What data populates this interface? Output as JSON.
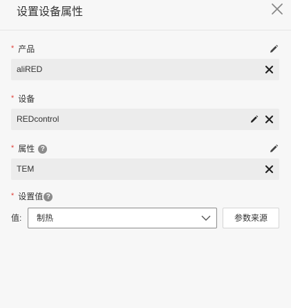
{
  "dialog": {
    "title": "设置设备属性"
  },
  "product": {
    "required_mark": "*",
    "label": "产品",
    "value": "aliRED"
  },
  "device": {
    "required_mark": "*",
    "label": "设备",
    "value": "REDcontrol"
  },
  "property": {
    "required_mark": "*",
    "label": "属性",
    "help": "?",
    "value": "TEM"
  },
  "set_value": {
    "required_mark": "*",
    "label": "设置值",
    "help": "?",
    "prefix": "值:",
    "selected": "制热",
    "param_source_button": "参数来源"
  },
  "colors": {
    "background": "#f7f7f7",
    "field_background": "#ececec",
    "required": "#e0413a",
    "help_icon": "#8c8c8c"
  },
  "icons": [
    "close-icon",
    "pencil-icon",
    "x-icon",
    "help-icon",
    "chevron-down-icon"
  ]
}
